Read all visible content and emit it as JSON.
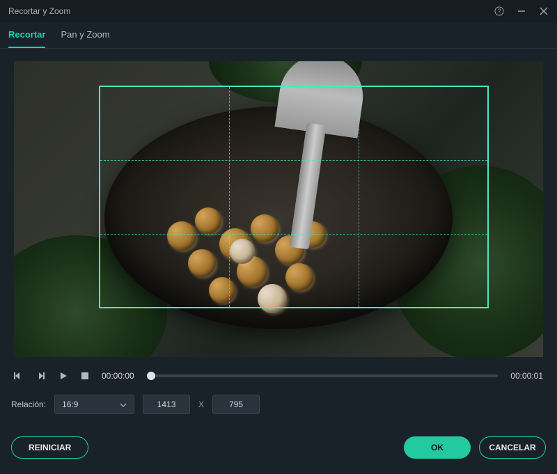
{
  "title": "Recortar y Zoom",
  "tabs": {
    "recortar": "Recortar",
    "pan_zoom": "Pan y Zoom"
  },
  "playback": {
    "current_time": "00:00:00",
    "total_time": "00:00:01"
  },
  "ratio": {
    "label": "Relación:",
    "value": "16:9",
    "width": "1413",
    "x": "X",
    "height": "795"
  },
  "buttons": {
    "reset": "REINICIAR",
    "ok": "OK",
    "cancel": "CANCELAR"
  }
}
